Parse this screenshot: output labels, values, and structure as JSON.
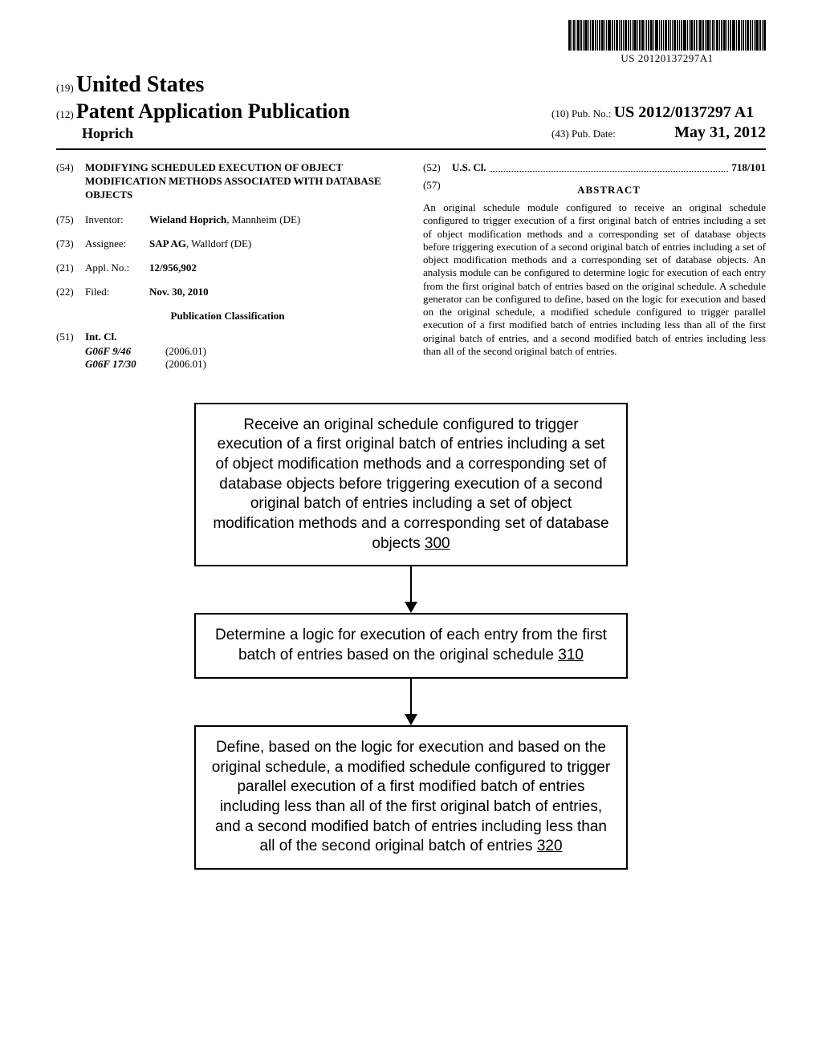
{
  "barcode_text": "US 20120137297A1",
  "header": {
    "code19": "(19)",
    "country": "United States",
    "code12": "(12)",
    "doc_type": "Patent Application Publication",
    "author": "Hoprich",
    "code10": "(10)",
    "pubno_label": "Pub. No.:",
    "pubno": "US 2012/0137297 A1",
    "code43": "(43)",
    "pubdate_label": "Pub. Date:",
    "pubdate": "May 31, 2012"
  },
  "left": {
    "code54": "(54)",
    "title": "MODIFYING SCHEDULED EXECUTION OF OBJECT MODIFICATION METHODS ASSOCIATED WITH DATABASE OBJECTS",
    "code75": "(75)",
    "inventor_label": "Inventor:",
    "inventor_name": "Wieland Hoprich",
    "inventor_loc": ", Mannheim (DE)",
    "code73": "(73)",
    "assignee_label": "Assignee:",
    "assignee_name": "SAP AG",
    "assignee_loc": ", Walldorf (DE)",
    "code21": "(21)",
    "applno_label": "Appl. No.:",
    "applno": "12/956,902",
    "code22": "(22)",
    "filed_label": "Filed:",
    "filed": "Nov. 30, 2010",
    "class_heading": "Publication Classification",
    "code51": "(51)",
    "intcl_label": "Int. Cl.",
    "intcl": [
      {
        "code": "G06F 9/46",
        "ver": "(2006.01)"
      },
      {
        "code": "G06F 17/30",
        "ver": "(2006.01)"
      }
    ]
  },
  "right": {
    "code52": "(52)",
    "uscl_label": "U.S. Cl.",
    "uscl_value": "718/101",
    "code57": "(57)",
    "abstract_heading": "ABSTRACT",
    "abstract": "An original schedule module configured to receive an original schedule configured to trigger execution of a first original batch of entries including a set of object modification methods and a corresponding set of database objects before triggering execution of a second original batch of entries including a set of object modification methods and a corresponding set of database objects. An analysis module can be configured to determine logic for execution of each entry from the first original batch of entries based on the original schedule. A schedule generator can be configured to define, based on the logic for execution and based on the original schedule, a modified schedule configured to trigger parallel execution of a first modified batch of entries including less than all of the first original batch of entries, and a second modified batch of entries including less than all of the second original batch of entries."
  },
  "flow": {
    "box1_text": "Receive an original schedule configured to trigger execution of a first original batch of entries including a set of object modification methods and a corresponding set of database objects before triggering execution of a second original batch of entries including a set of object modification methods and a corresponding set of database objects ",
    "box1_ref": "300",
    "box2_text": "Determine a logic for execution of each entry from the first batch of entries based on the original schedule ",
    "box2_ref": "310",
    "box3_text": "Define, based on the logic for execution and based on the original schedule, a modified schedule configured to trigger parallel execution of a first modified batch of entries including less than all of the first original batch of entries, and a second modified batch of entries including less than all of the second original batch of entries ",
    "box3_ref": "320"
  }
}
